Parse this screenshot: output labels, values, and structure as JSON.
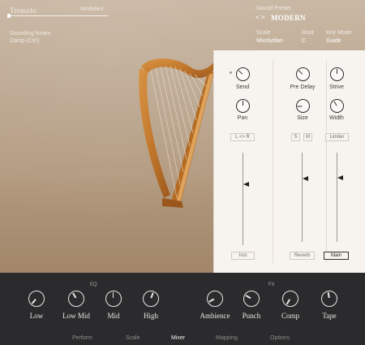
{
  "header": {
    "preset_tab": "Tremolo",
    "model_tab": "Modelled",
    "sounding_notes_label": "Sounding Notes",
    "sounding_notes_value": "Damp (Ctrl)",
    "sound_preset_label": "Sound Preset",
    "sound_preset_arrows": "< >",
    "sound_preset_value": "MODERN",
    "scale_label": "Scale",
    "scale_value": "Mixolydian",
    "root_label": "Root",
    "root_value": "C",
    "key_mode_label": "Key Mode",
    "key_mode_value": "Guide"
  },
  "mixer": {
    "send_label": "Send",
    "pan_label": "Pan",
    "pan_mode_button": "L <> R",
    "pre_delay_label": "Pre Delay",
    "size_label": "Size",
    "strive_label": "Strive",
    "width_label": "Width",
    "solo_button": "S",
    "mute_button": "M",
    "limiter_button": "Limiter",
    "inst_button": "Inst",
    "reverb_button": "Reverb",
    "main_button": "Main"
  },
  "bottom": {
    "eq_label": "EQ",
    "fx_label": "FX",
    "eq_knobs": [
      "Low",
      "Low Mid",
      "Mid",
      "High"
    ],
    "fx_knobs": [
      "Ambience",
      "Punch",
      "Comp",
      "Tape"
    ],
    "nav": [
      "Perform",
      "Scale",
      "Mixer",
      "Mapping",
      "Options"
    ],
    "active_nav": "Mixer"
  },
  "colors": {
    "panel_bg": "#f7f4ef",
    "bottom_bar": "#2b2b2e",
    "harp_wood": "#c47a2c"
  }
}
